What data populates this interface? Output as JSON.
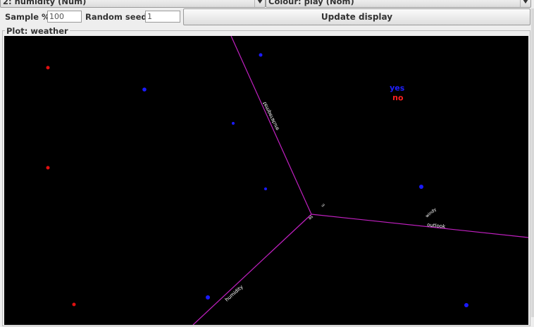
{
  "selectors": {
    "x_attribute": "2: humidity (Num)",
    "colour": "Colour: play (Nom)"
  },
  "controls": {
    "sample_label": "Sample %",
    "sample_value": "100",
    "seed_label": "Random seed",
    "seed_value": "1",
    "update_button": "Update display"
  },
  "plot": {
    "title": "Plot: weather",
    "axes": [
      "temperature",
      "outlook",
      "windy",
      "humidity"
    ],
    "legend": [
      {
        "label": "yes",
        "color": "#1f1fff"
      },
      {
        "label": "no",
        "color": "#ff1f1f"
      }
    ],
    "class_colors": {
      "yes": "#1a1aff",
      "no": "#e01010"
    },
    "axis_color": "#c020c0"
  }
}
